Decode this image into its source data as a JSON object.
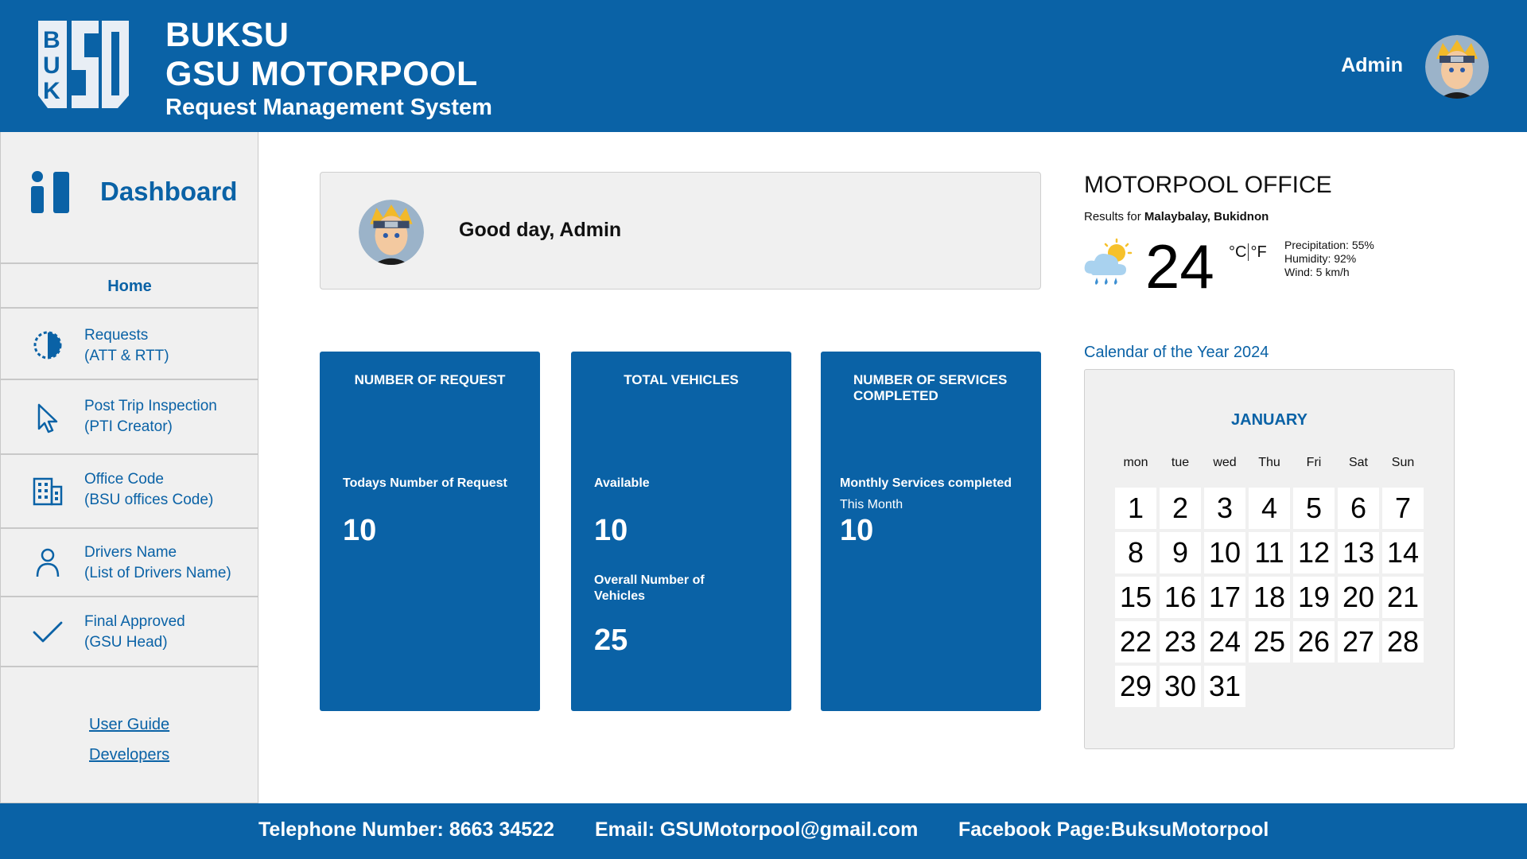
{
  "header": {
    "brand_line1": "BUKSU",
    "brand_line2": "GSU MOTORPOOL",
    "brand_line3": "Request Management System",
    "user_name": "Admin"
  },
  "sidebar": {
    "dashboard_label": "Dashboard",
    "home_label": "Home",
    "items": [
      {
        "line1": "Requests",
        "line2": "(ATT & RTT)",
        "icon": "half-circle-icon"
      },
      {
        "line1": "Post Trip Inspection",
        "line2": "(PTI Creator)",
        "icon": "cursor-icon"
      },
      {
        "line1": "Office Code",
        "line2": "(BSU offices Code)",
        "icon": "building-icon"
      },
      {
        "line1": "Drivers Name",
        "line2": "(List of Drivers Name)",
        "icon": "person-icon"
      },
      {
        "line1": "Final Approved",
        "line2": "(GSU Head)",
        "icon": "checkmark-icon"
      }
    ],
    "links": [
      "User Guide",
      "Developers"
    ]
  },
  "greeting": "Good day, Admin",
  "cards": [
    {
      "title": "NUMBER OF REQUEST",
      "label": "Todays Number of Request",
      "value": "10"
    },
    {
      "title": "TOTAL VEHICLES",
      "label": "Available",
      "value": "10",
      "label2": "Overall Number of Vehicles",
      "value2": "25"
    },
    {
      "title": "NUMBER OF SERVICES COMPLETED",
      "label": "Monthly Services completed",
      "sub": "This Month",
      "value": "10"
    }
  ],
  "weather": {
    "title": "MOTORPOOL OFFICE",
    "results_prefix": "Results for",
    "location": "Malaybalay, Bukidnon",
    "temperature": "24",
    "unit_c": "°C",
    "unit_f": "°F",
    "precipitation": "Precipitation: 55%",
    "humidity": "Humidity: 92%",
    "wind": "Wind: 5 km/h",
    "icon": "cloud-sun-rain-icon"
  },
  "calendar": {
    "caption": "Calendar of the Year 2024",
    "month": "JANUARY",
    "weekdays": [
      "mon",
      "tue",
      "wed",
      "Thu",
      "Fri",
      "Sat",
      "Sun"
    ],
    "days": [
      "1",
      "2",
      "3",
      "4",
      "5",
      "6",
      "7",
      "8",
      "9",
      "10",
      "11",
      "12",
      "13",
      "14",
      "15",
      "16",
      "17",
      "18",
      "19",
      "20",
      "21",
      "22",
      "23",
      "24",
      "25",
      "26",
      "27",
      "28",
      "29",
      "30",
      "31"
    ]
  },
  "footer": {
    "telephone": "Telephone Number: 8663 34522",
    "email": "Email: GSUMotorpool@gmail.com",
    "facebook": "Facebook Page:BuksuMotorpool"
  },
  "colors": {
    "primary": "#0a62a6",
    "panel": "#f0f0f0"
  }
}
